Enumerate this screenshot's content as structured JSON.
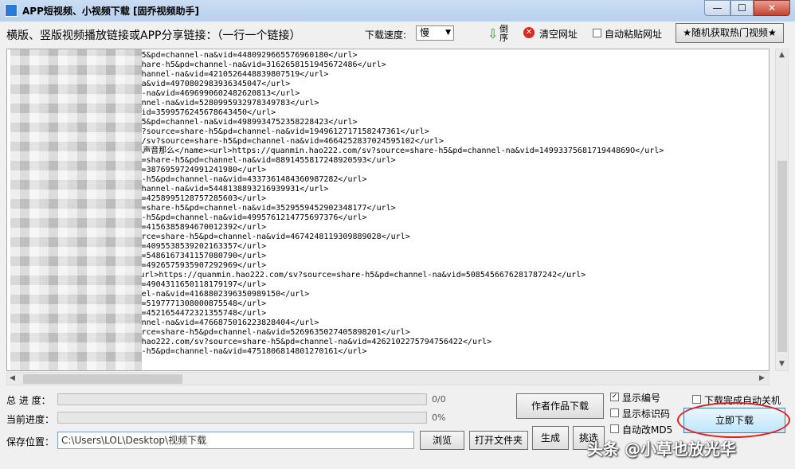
{
  "window": {
    "title": "APP短视频、小视频下载 [固乔视频助手]",
    "minimize": "—",
    "maximize": "☐",
    "close": "✕"
  },
  "toolbar": {
    "instruction": "横版、竖版视频播放链接或APP分享链接：（一行一个链接）",
    "speed_label": "下载速度:",
    "speed_value": "慢",
    "speed_arrow": "▼",
    "reverse_icon": "⇩",
    "reverse_label": "倒序",
    "clear_icon": "✕",
    "clear_label": "清空网址",
    "auto_paste_label": "自动粘贴网址",
    "hot_button_label": "★随机获取热门视频★"
  },
  "url_lines": [
    "        om/sv?source=share-h5&pd=channel-na&vid=4480929665576960180</url>",
    "        o222.com/sv?source=share-h5&pd=channel-na&vid=3162658151945672486</url>",
    "        source=share-h5&pd=channel-na&vid=4210526448839807519</url>",
    "        hare-h5&pd=channel-na&vid=4970802983936345047</url>",
    "        =share-h5&pd=channel-na&vid=4696990602482620813</url>",
    "        urce=share-h5&pd=channel-na&vid=5280995932978349783</url>",
    "        e-h5&pd=channel-na&vid=3599576245678643450</url>",
    "        om/sv?source=share-h5&pd=channel-na&vid=4989934752358228423</url>",
    "        uanmin.hao222.com/sv?source=share-h5&pd=channel-na&vid=1949612717158247361</url>",
    "        //quanmin.hao222.com/sv?source=share-h5&pd=channel-na&vid=4664252837024595102</url>",
    "        : 只是试一下，没想到自己声音那么</name><url>https://quanmin.hao222.com/sv?source=share-h5&pd=channel-na&vid=1499337568171944869O</url>",
    "        hao222.com/sv?source=share-h5&pd=channel-na&vid=8891455817248920593</url>",
    "        h5&pd=channel-na&vid=3876959724991241980</url>",
    "        .com/sv?source=share-h5&pd=channel-na&vid=4337361484360987282</url>",
    "        source=share-h5&pd=channel-na&vid=5448138893216939931</url>",
    "        h5&pd=channel-na&vid=4258995128757285603</url>",
    "        hao222.com/sv?source=share-h5&pd=channel-na&vid=3529559452902348177</url>",
    "        .com/sv?source=share-h5&pd=channel-na&vid=4995761214775697376</url>",
    "        h5&pd=channel-na&vid=4156385894670012392</url>",
    "        in.hao222.com/sv?source=share-h5&pd=channel-na&vid=4674248119309889028</url>",
    "        h5&pd=channel-na&vid=4095538539202163357</url>",
    "        h5&pd=channel-na&vid=5486167341157080790</url>",
    "        h5&pd=channel-na&vid=4926575935907292969</url>",
    "        防员赶来火已灭</name><url>https://quanmin.hao222.com/sv?source=share-h5&pd=channel-na&vid=5085456676281787242</url>",
    "        h5&pd=channel-na&vid=4904311650118179197</url>",
    "        ce=share-h5&pd=channel-na&vid=4168802396350989150</url>",
    "        h5&pd=channel-na&vid=5197771308000875548</url>",
    "        h5&pd=channel-na&vid=4521654472321355748</url>",
    "        urce=share-h5&pd=channel-na&vid=4766875016223828404</url>",
    "        in.hao222.com/sv?source=share-h5&pd=channel-na&vid=5269635027405898201</url>",
    "        url>https://quanmin.hao222.com/sv?source=share-h5&pd=channel-na&vid=4262102275794756422</url>",
    "        .com/sv?source=share-h5&pd=channel-na&vid=4751806814801270161</url>"
  ],
  "progress": {
    "total_label": "总 进 度：",
    "total_text": "0/0",
    "total_value": 0,
    "current_label": "当前进度：",
    "current_text": "0%",
    "current_value": 0
  },
  "save": {
    "label": "保存位置：",
    "path": "C:\\Users\\LOL\\Desktop\\视频下载",
    "browse": "浏览",
    "open_folder": "打开文件夹"
  },
  "buttons": {
    "author_works": "作者作品下载",
    "generate": "生成",
    "pick": "挑选",
    "download_now": "立即下载"
  },
  "options": {
    "show_number": "显示编号",
    "show_number_checked": true,
    "show_id": "显示标识码",
    "show_id_checked": false,
    "auto_md5": "自动改MD5",
    "auto_md5_checked": false,
    "shutdown": "下载完成自动关机",
    "shutdown_checked": false
  },
  "watermark": "头条 @小草也放光华"
}
